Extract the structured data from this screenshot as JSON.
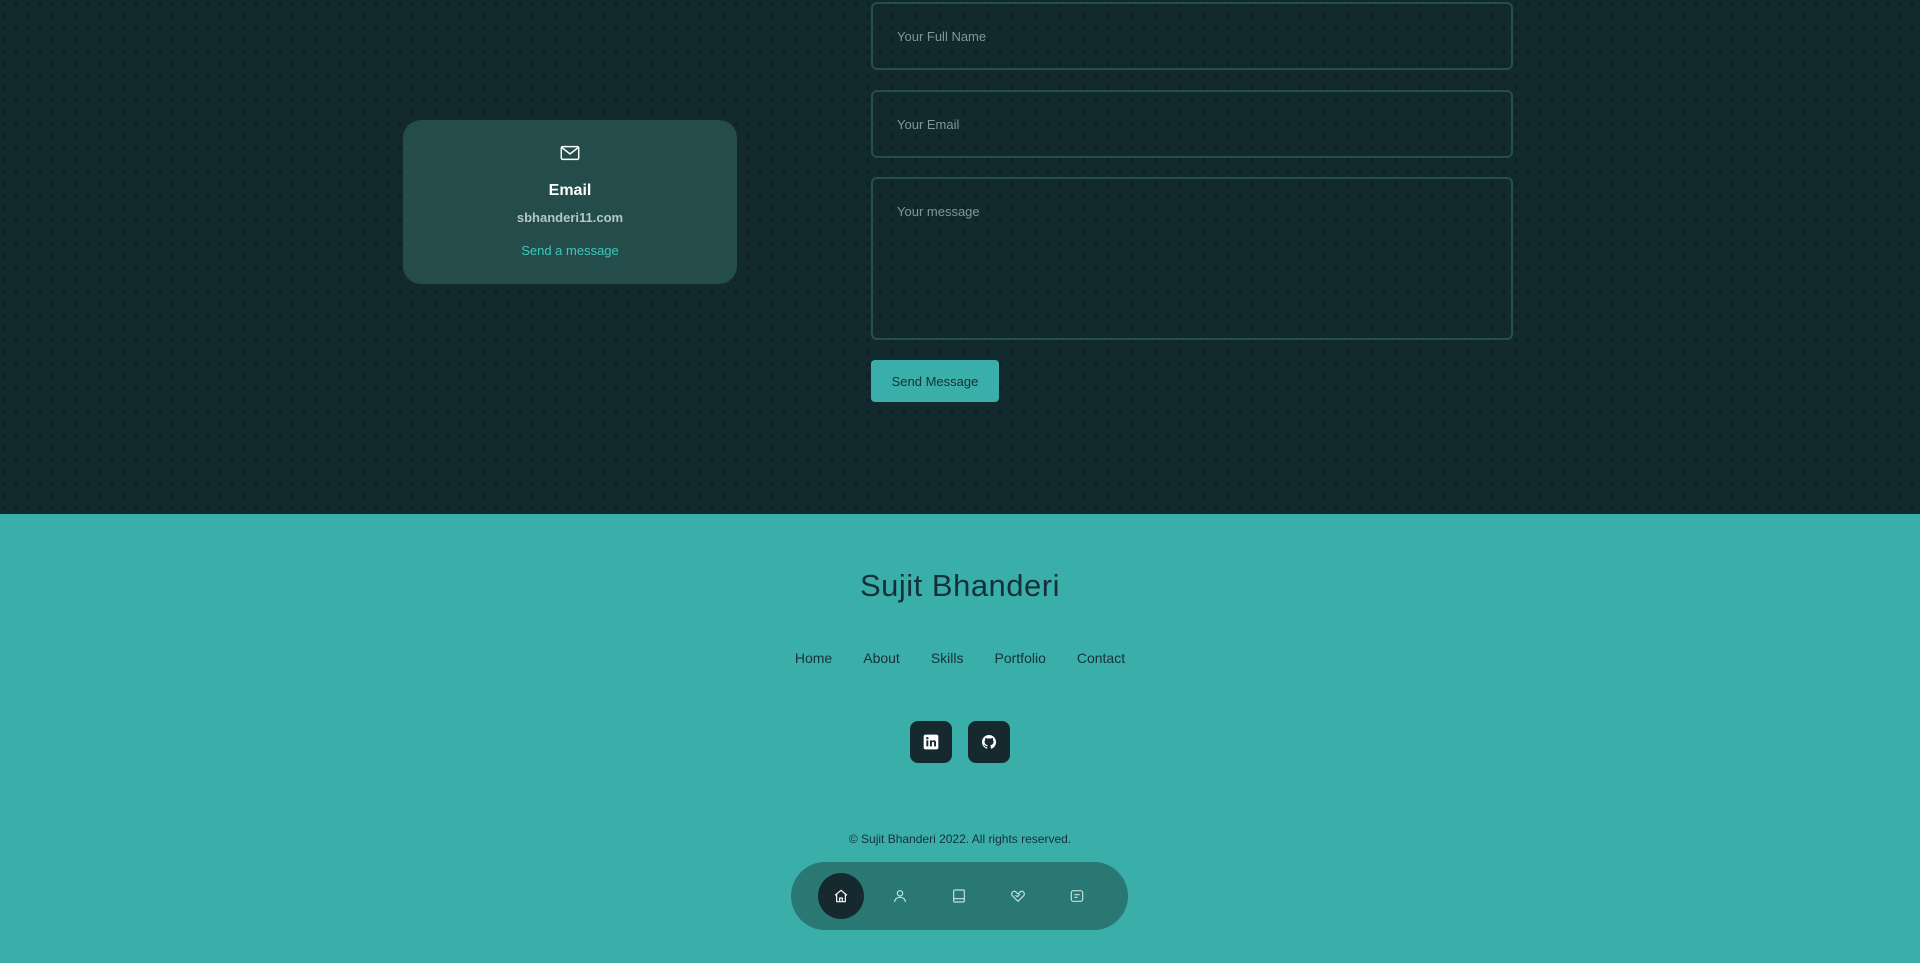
{
  "contact_card": {
    "icon": "mail-icon",
    "title": "Email",
    "address": "sbhanderi11.com",
    "link_label": "Send a message"
  },
  "form": {
    "name_placeholder": "Your Full Name",
    "email_placeholder": "Your Email",
    "message_placeholder": "Your message",
    "submit_label": "Send Message"
  },
  "footer": {
    "title": "Sujit Bhanderi",
    "nav": [
      "Home",
      "About",
      "Skills",
      "Portfolio",
      "Contact"
    ],
    "socials": [
      "linkedin-icon",
      "github-icon"
    ],
    "copyright": "© Sujit Bhanderi 2022. All rights reserved."
  },
  "bottom_nav": {
    "items": [
      "home-icon",
      "user-icon",
      "book-icon",
      "services-icon",
      "message-icon"
    ],
    "active": "home-icon"
  },
  "colors": {
    "background_dark": "#122a2e",
    "card": "#234c4a",
    "accent": "#3aafa9",
    "link": "#3cc9bd",
    "footer_text": "#15303a",
    "bottom_nav": "#2a7874",
    "dark_button": "#16292e"
  }
}
